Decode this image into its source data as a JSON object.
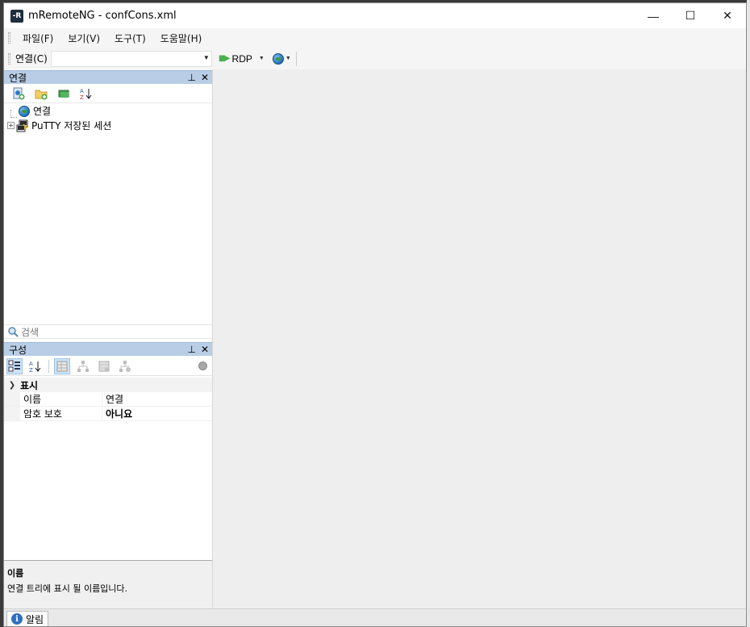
{
  "window": {
    "title": "mRemoteNG - confCons.xml",
    "app_icon_text": "-R"
  },
  "window_controls": {
    "minimize": "—",
    "maximize": "☐",
    "close": "✕"
  },
  "menu": {
    "items": [
      "파일(F)",
      "보기(V)",
      "도구(T)",
      "도움말(H)"
    ]
  },
  "toolbar": {
    "connect_label": "연결(C)",
    "protocol_label": "RDP"
  },
  "connections_panel": {
    "title": "연결",
    "tree": [
      {
        "label": "연결",
        "icon": "globe-icon"
      },
      {
        "label": "PuTTY 저장된 세션",
        "icon": "putty-icon"
      }
    ],
    "search_placeholder": "검색"
  },
  "config_panel": {
    "title": "구성",
    "category": "표시",
    "properties": [
      {
        "name": "이름",
        "value": "연결",
        "bold": false
      },
      {
        "name": "암호 보호",
        "value": "아니요",
        "bold": true
      }
    ],
    "description_title": "이름",
    "description_text": "연결 트리에 표시 될 이름입니다."
  },
  "statusbar": {
    "alert_tab_label": "알림"
  }
}
